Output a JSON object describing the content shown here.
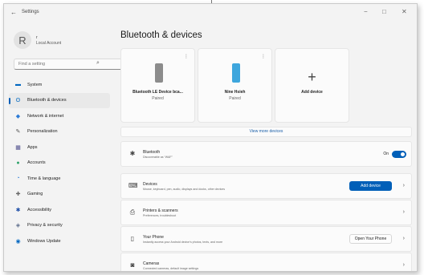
{
  "window": {
    "title": "Settings",
    "back_icon": "←",
    "minimize": "−",
    "maximize": "□",
    "close": "✕"
  },
  "user": {
    "initial": "R",
    "name": "r",
    "account": "Local Account"
  },
  "search": {
    "placeholder": "Find a setting",
    "icon": "⌕"
  },
  "sidebar": {
    "items": [
      {
        "label": "System",
        "icon": "▬",
        "color": "#0067c0"
      },
      {
        "label": "Bluetooth & devices",
        "icon": "ʘ",
        "color": "#0067c0",
        "active": true
      },
      {
        "label": "Network & internet",
        "icon": "◆",
        "color": "#2c7bd6"
      },
      {
        "label": "Personalization",
        "icon": "✎",
        "color": "#555555"
      },
      {
        "label": "Apps",
        "icon": "▦",
        "color": "#4a4a8a"
      },
      {
        "label": "Accounts",
        "icon": "●",
        "color": "#2fa36b"
      },
      {
        "label": "Time & language",
        "icon": "◔",
        "color": "#2c7bd6"
      },
      {
        "label": "Gaming",
        "icon": "✚",
        "color": "#666666"
      },
      {
        "label": "Accessibility",
        "icon": "✱",
        "color": "#1f4fa8"
      },
      {
        "label": "Privacy & security",
        "icon": "◈",
        "color": "#5a6a8a"
      },
      {
        "label": "Windows Update",
        "icon": "◉",
        "color": "#0067c0"
      }
    ]
  },
  "main": {
    "title": "Bluetooth & devices",
    "devices": [
      {
        "name": "Bluetooth LE Device bca...",
        "status": "Paired",
        "more": "⋮",
        "color": "#8c8c8c"
      },
      {
        "name": "Nine Hsieh",
        "status": "Paired",
        "more": "⋮",
        "color": "#3ea6dd"
      }
    ],
    "add_device_card": {
      "plus": "+",
      "label": "Add device"
    },
    "view_more": "View more devices",
    "bluetooth": {
      "icon": "✱",
      "title": "Bluetooth",
      "desc": "Discoverable as “WAF”",
      "toggle_label": "On"
    },
    "rows": [
      {
        "icon": "⌨",
        "title": "Devices",
        "desc": "Mouse, keyboard, pen, audio, displays and docks, other devices",
        "button": "Add device",
        "button_style": "primary"
      },
      {
        "icon": "⎙",
        "title": "Printers & scanners",
        "desc": "Preferences, troubleshoot"
      },
      {
        "icon": "▯",
        "title": "Your Phone",
        "desc": "Instantly access your Android device's photos, texts, and more",
        "button": "Open Your Phone",
        "button_style": "secondary"
      },
      {
        "icon": "◙",
        "title": "Cameras",
        "desc": "Connected cameras, default image settings"
      }
    ],
    "chevron": "›"
  }
}
